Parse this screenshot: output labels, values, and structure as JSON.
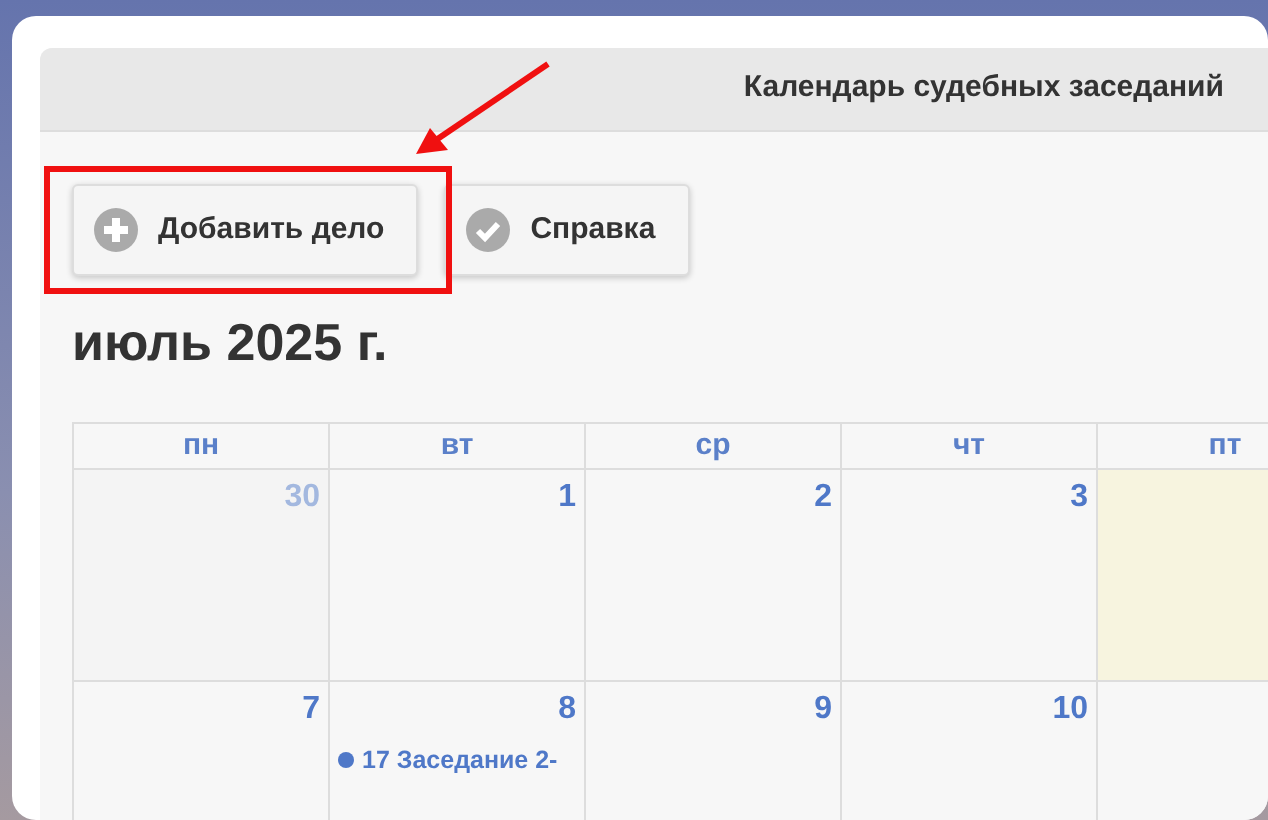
{
  "header": {
    "title": "Календарь судебных заседаний"
  },
  "buttons": [
    {
      "label": "Добавить дело",
      "kind": "add"
    },
    {
      "label": "Справка",
      "kind": "help"
    }
  ],
  "month_title": "июль 2025 г.",
  "calendar": {
    "weekdays": [
      "пн",
      "вт",
      "ср",
      "чт",
      "пт"
    ],
    "weeks": [
      [
        {
          "day": "30",
          "other_month": true,
          "today": false
        },
        {
          "day": "1",
          "other_month": false,
          "today": false
        },
        {
          "day": "2",
          "other_month": false,
          "today": false
        },
        {
          "day": "3",
          "other_month": false,
          "today": false
        },
        {
          "other_month": false,
          "today": true
        }
      ],
      [
        {
          "day": "7",
          "other_month": false,
          "today": false
        },
        {
          "day": "8",
          "other_month": false,
          "today": false,
          "events": [
            "17 Заседание 2-"
          ]
        },
        {
          "day": "9",
          "other_month": false,
          "today": false
        },
        {
          "day": "10",
          "other_month": false,
          "today": false
        },
        {
          "other_month": false,
          "today": false
        }
      ]
    ]
  }
}
